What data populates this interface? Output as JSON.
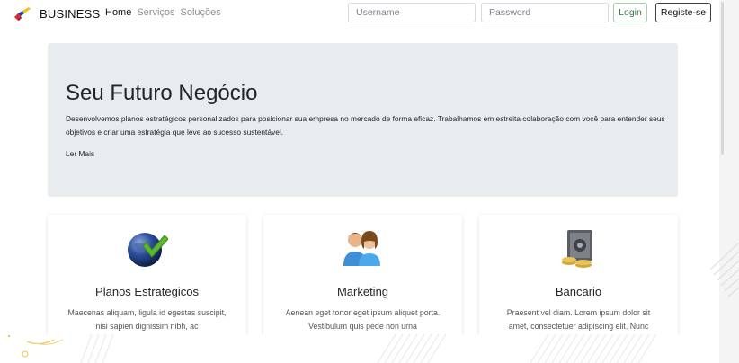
{
  "navbar": {
    "brand": "BUSINESS",
    "links": [
      {
        "label": "Home",
        "active": true
      },
      {
        "label": "Serviços",
        "active": false
      },
      {
        "label": "Soluções",
        "active": false
      }
    ],
    "username_placeholder": "Username",
    "password_placeholder": "Password",
    "login_label": "Login",
    "register_label": "Registe-se"
  },
  "hero": {
    "title": "Seu Futuro Negócio",
    "text": "Desenvolvemos planos estratégicos personalizados para posicionar sua empresa no mercado de forma eficaz. Trabalhamos em estreita colaboração com você para entender seus objetivos e criar uma estratégia que leve ao sucesso sustentável.",
    "more_label": "Ler Mais"
  },
  "cards": [
    {
      "icon": "globe-check-icon",
      "title": "Planos Estrategicos",
      "text": "Maecenas aliquam, ligula id egestas suscipit, nisi sapien dignissim nibh, ac"
    },
    {
      "icon": "people-icon",
      "title": "Marketing",
      "text": "Aenean eget tortor eget ipsum aliquet porta. Vestibulum quis pede non urna"
    },
    {
      "icon": "safe-coins-icon",
      "title": "Bancario",
      "text": "Praesent vel diam. Lorem ipsum dolor sit amet, consectetuer adipiscing elit. Nunc"
    }
  ],
  "colors": {
    "hero_bg": "#e9ecef",
    "login_border": "#9fd4ab",
    "login_text": "#2f7d45",
    "register_border": "#3b3f44"
  }
}
